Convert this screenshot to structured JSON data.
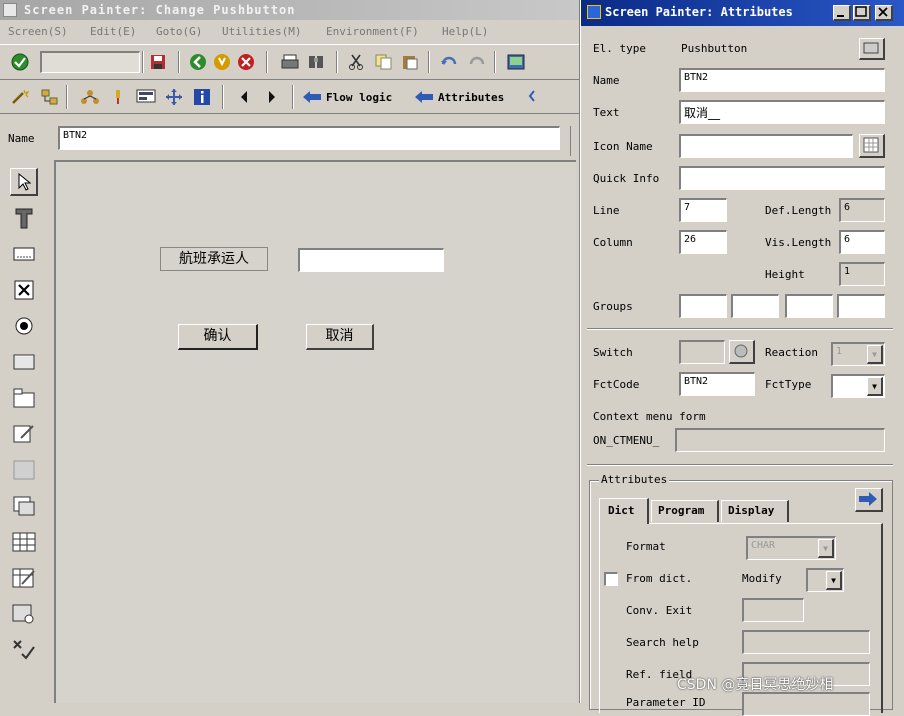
{
  "main_window": {
    "title": "Screen Painter:  Change Pushbutton",
    "menu": [
      "Screen(S)",
      "Edit(E)",
      "Goto(G)",
      "Utilities(M)",
      "Environment(F)",
      "Help(L)"
    ],
    "toolbar2": {
      "flow_logic": "Flow logic",
      "attributes": "Attributes"
    },
    "name_label": "Name",
    "name_value": "BTN2",
    "canvas": {
      "label_text": "航班承运人",
      "btn_ok": "确认",
      "btn_cancel": "取消"
    }
  },
  "attr_window": {
    "title": "Screen Painter: Attributes",
    "el_type_label": "El. type",
    "el_type_value": "Pushbutton",
    "name_label": "Name",
    "name_value": "BTN2",
    "text_label": "Text",
    "text_value": "取消__",
    "icon_name_label": "Icon Name",
    "icon_name_value": "",
    "quick_info_label": "Quick Info",
    "quick_info_value": "",
    "line_label": "Line",
    "line_value": "7",
    "def_length_label": "Def.Length",
    "def_length_value": "6",
    "column_label": "Column",
    "column_value": "26",
    "vis_length_label": "Vis.Length",
    "vis_length_value": "6",
    "height_label": "Height",
    "height_value": "1",
    "groups_label": "Groups",
    "switch_label": "Switch",
    "reaction_label": "Reaction",
    "reaction_value": "1",
    "fctcode_label": "FctCode",
    "fctcode_value": "BTN2",
    "fcttype_label": "FctType",
    "fcttype_value": "",
    "context_menu_label": "Context menu form",
    "on_ctmenu_label": "ON_CTMENU_",
    "attributes_group_label": "Attributes",
    "tabs": [
      "Dict",
      "Program",
      "Display"
    ],
    "format_label": "Format",
    "format_value": "CHAR",
    "from_dict_label": "From dict.",
    "modify_label": "Modify",
    "conv_exit_label": "Conv. Exit",
    "search_help_label": "Search help",
    "ref_field_label": "Ref. field",
    "cut_label": "Parameter ID"
  },
  "watermark": "CSDN @竟日冥思绝妙相"
}
